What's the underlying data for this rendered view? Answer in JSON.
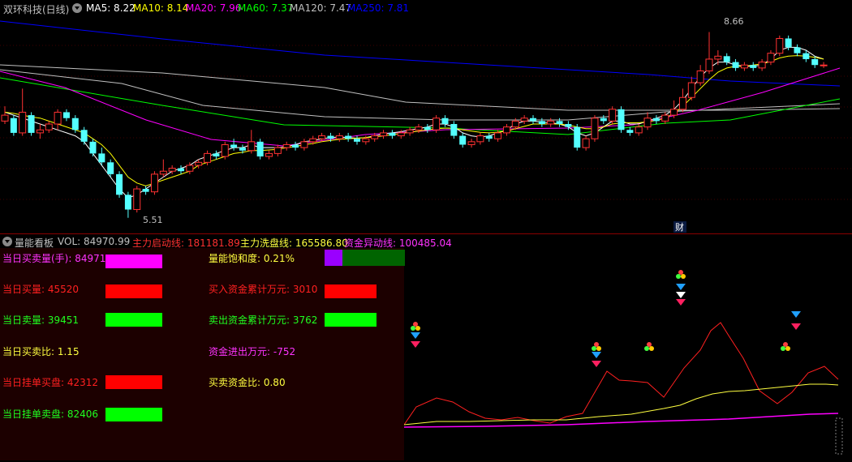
{
  "header": {
    "title": "双环科技(日线)",
    "ma5": "MA5: 8.22",
    "ma10": "MA10: 8.14",
    "ma20": "MA20: 7.96",
    "ma60": "MA60: 7.37",
    "ma120": "MA120: 7.47",
    "ma250": "MA250: 7.81"
  },
  "main_chart": {
    "high_label": "8.66",
    "low_label": "5.51",
    "cai_marker": "财"
  },
  "lower_header": {
    "title": "量能看板",
    "vol": "VOL: 84970.99",
    "zl_qd": "主力启动线: 181181.89",
    "zl_xp": "主力洗盘线: 165586.80",
    "zj_yd": "资金异动线: 100485.04"
  },
  "panel": {
    "left": [
      {
        "label": "当日买卖量(手): 84971",
        "color": "#ff33ff",
        "box": "#ff00ff"
      },
      {
        "label": "当日买量: 45520",
        "color": "#ff2020",
        "box": "#ff0000"
      },
      {
        "label": "当日卖量: 39451",
        "color": "#20ff20",
        "box": "#00ff00"
      },
      {
        "label": "当日买卖比: 1.15",
        "color": "#ffff40",
        "box": ""
      },
      {
        "label": "当日挂单买盘: 42312",
        "color": "#ff2020",
        "box": "#ff0000"
      },
      {
        "label": "当日挂单卖盘: 82406",
        "color": "#20ff20",
        "box": "#00ff00"
      }
    ],
    "right": [
      {
        "label": "量能饱和度: 0.21%",
        "color": "#ffff40",
        "box": "split"
      },
      {
        "label": "买入资金累计万元: 3010",
        "color": "#ff2020",
        "box": "#ff0000"
      },
      {
        "label": "卖出资金累计万元: 3762",
        "color": "#20ff20",
        "box": "#00ff00"
      },
      {
        "label": "资金进出万元: -752",
        "color": "#ff33ff",
        "box": ""
      },
      {
        "label": "买卖资金比: 0.80",
        "color": "#ffff40",
        "box": ""
      }
    ]
  },
  "colors": {
    "up": "#ff3232",
    "down": "#54ffff",
    "ma5": "#ffffff",
    "ma10": "#ffff00",
    "ma20": "#ff00ff",
    "ma60": "#00ff00",
    "ma120": "#c0c0c0",
    "ma250": "#0000ff"
  },
  "chart_data": {
    "type": "candlestick",
    "price_range": [
      5.3,
      8.9
    ],
    "candles": [
      [
        7.15,
        7.25,
        7.4,
        7.1
      ],
      [
        7.2,
        6.95,
        7.25,
        6.9
      ],
      [
        6.95,
        7.3,
        7.7,
        6.9
      ],
      [
        7.25,
        6.95,
        7.3,
        6.9
      ],
      [
        6.95,
        7.0,
        7.1,
        6.85
      ],
      [
        7.0,
        7.1,
        7.15,
        6.95
      ],
      [
        7.1,
        7.3,
        7.35,
        7.0
      ],
      [
        7.3,
        7.2,
        7.35,
        7.15
      ],
      [
        7.2,
        7.0,
        7.25,
        6.95
      ],
      [
        7.0,
        6.8,
        7.05,
        6.75
      ],
      [
        6.8,
        6.6,
        6.85,
        6.55
      ],
      [
        6.6,
        6.45,
        6.7,
        6.4
      ],
      [
        6.45,
        6.25,
        6.5,
        6.2
      ],
      [
        6.25,
        5.9,
        6.3,
        5.85
      ],
      [
        5.9,
        5.65,
        5.95,
        5.51
      ],
      [
        5.65,
        6.0,
        6.05,
        5.6
      ],
      [
        6.0,
        5.95,
        6.05,
        5.9
      ],
      [
        5.95,
        6.25,
        6.3,
        5.9
      ],
      [
        6.25,
        6.3,
        6.5,
        6.2
      ],
      [
        6.3,
        6.35,
        6.4,
        6.25
      ],
      [
        6.35,
        6.3,
        6.4,
        6.25
      ],
      [
        6.3,
        6.4,
        6.45,
        6.25
      ],
      [
        6.4,
        6.45,
        6.5,
        6.35
      ],
      [
        6.45,
        6.6,
        6.65,
        6.4
      ],
      [
        6.6,
        6.55,
        6.65,
        6.5
      ],
      [
        6.55,
        6.75,
        6.8,
        6.5
      ],
      [
        6.75,
        6.7,
        6.85,
        6.65
      ],
      [
        6.7,
        6.65,
        6.75,
        6.6
      ],
      [
        6.65,
        6.8,
        7.0,
        6.6
      ],
      [
        6.8,
        6.55,
        6.85,
        6.5
      ],
      [
        6.55,
        6.6,
        6.65,
        6.5
      ],
      [
        6.6,
        6.7,
        6.75,
        6.55
      ],
      [
        6.7,
        6.75,
        6.8,
        6.65
      ],
      [
        6.75,
        6.7,
        6.8,
        6.65
      ],
      [
        6.7,
        6.8,
        6.85,
        6.65
      ],
      [
        6.8,
        6.85,
        6.9,
        6.75
      ],
      [
        6.85,
        6.9,
        6.95,
        6.8
      ],
      [
        6.9,
        6.85,
        6.95,
        6.8
      ],
      [
        6.85,
        6.9,
        6.95,
        6.8
      ],
      [
        6.9,
        6.85,
        6.95,
        6.8
      ],
      [
        6.85,
        6.8,
        6.9,
        6.75
      ],
      [
        6.8,
        6.85,
        6.9,
        6.75
      ],
      [
        6.85,
        6.9,
        6.95,
        6.8
      ],
      [
        6.9,
        6.95,
        7.0,
        6.85
      ],
      [
        6.95,
        6.9,
        7.0,
        6.85
      ],
      [
        6.9,
        6.95,
        7.0,
        6.85
      ],
      [
        6.95,
        7.0,
        7.05,
        6.9
      ],
      [
        7.0,
        7.05,
        7.1,
        6.95
      ],
      [
        7.05,
        7.0,
        7.1,
        6.95
      ],
      [
        7.0,
        7.2,
        7.25,
        6.95
      ],
      [
        7.2,
        7.1,
        7.25,
        7.05
      ],
      [
        7.1,
        6.9,
        7.15,
        6.85
      ],
      [
        6.9,
        6.75,
        6.95,
        6.7
      ],
      [
        6.75,
        6.8,
        6.85,
        6.7
      ],
      [
        6.8,
        6.9,
        6.95,
        6.75
      ],
      [
        6.9,
        6.85,
        6.95,
        6.8
      ],
      [
        6.85,
        6.95,
        7.0,
        6.8
      ],
      [
        6.95,
        7.05,
        7.1,
        6.9
      ],
      [
        7.05,
        7.15,
        7.2,
        7.0
      ],
      [
        7.15,
        7.2,
        7.25,
        7.1
      ],
      [
        7.2,
        7.15,
        7.25,
        7.1
      ],
      [
        7.15,
        7.1,
        7.2,
        7.05
      ],
      [
        7.1,
        7.15,
        7.2,
        7.05
      ],
      [
        7.15,
        7.1,
        7.2,
        7.05
      ],
      [
        7.1,
        7.05,
        7.15,
        7.0
      ],
      [
        7.05,
        6.7,
        7.1,
        6.65
      ],
      [
        6.7,
        6.85,
        6.9,
        6.65
      ],
      [
        6.85,
        7.2,
        7.25,
        6.8
      ],
      [
        7.2,
        7.15,
        7.25,
        7.1
      ],
      [
        7.15,
        7.35,
        7.4,
        7.1
      ],
      [
        7.35,
        7.0,
        7.4,
        6.95
      ],
      [
        7.0,
        6.95,
        7.05,
        6.9
      ],
      [
        6.95,
        7.05,
        7.1,
        6.9
      ],
      [
        7.05,
        7.2,
        7.3,
        7.0
      ],
      [
        7.2,
        7.15,
        7.25,
        7.1
      ],
      [
        7.15,
        7.25,
        7.3,
        7.1
      ],
      [
        7.25,
        7.35,
        7.5,
        7.2
      ],
      [
        7.35,
        7.55,
        7.7,
        7.3
      ],
      [
        7.55,
        7.8,
        7.9,
        7.5
      ],
      [
        7.8,
        8.0,
        8.1,
        7.75
      ],
      [
        8.0,
        8.2,
        8.66,
        7.95
      ],
      [
        8.2,
        8.25,
        8.35,
        8.1
      ],
      [
        8.25,
        8.15,
        8.3,
        8.1
      ],
      [
        8.15,
        8.05,
        8.2,
        8.0
      ],
      [
        8.05,
        8.1,
        8.15,
        8.0
      ],
      [
        8.1,
        8.05,
        8.15,
        8.0
      ],
      [
        8.05,
        8.15,
        8.2,
        8.0
      ],
      [
        8.15,
        8.3,
        8.35,
        8.1
      ],
      [
        8.3,
        8.55,
        8.6,
        8.25
      ],
      [
        8.55,
        8.4,
        8.6,
        8.35
      ],
      [
        8.4,
        8.3,
        8.45,
        8.25
      ],
      [
        8.3,
        8.2,
        8.35,
        8.15
      ],
      [
        8.2,
        8.1,
        8.25,
        8.05
      ],
      [
        8.1,
        8.1,
        8.15,
        8.05
      ]
    ],
    "ma_lines": {
      "MA5": [
        7.3,
        7.25,
        7.2,
        7.15,
        7.1,
        7.05,
        7.0,
        6.95,
        6.9,
        6.8,
        6.6,
        6.4,
        6.2,
        6.0,
        5.85,
        5.9,
        6.0,
        6.1,
        6.2,
        6.3,
        6.35,
        6.4,
        6.5,
        6.55,
        6.6,
        6.65,
        6.7,
        6.7,
        6.75,
        6.7,
        6.7,
        6.7,
        6.72,
        6.75,
        6.8,
        6.82,
        6.85,
        6.87,
        6.88,
        6.87,
        6.86,
        6.87,
        6.9,
        6.93,
        6.95,
        6.97,
        7.0,
        7.02,
        7.05,
        7.1,
        7.1,
        7.05,
        6.95,
        6.9,
        6.88,
        6.9,
        6.95,
        7.0,
        7.1,
        7.15,
        7.15,
        7.13,
        7.12,
        7.1,
        7.05,
        6.95,
        6.9,
        6.95,
        7.05,
        7.15,
        7.15,
        7.1,
        7.1,
        7.15,
        7.2,
        7.25,
        7.35,
        7.5,
        7.7,
        7.9,
        8.05,
        8.15,
        8.15,
        8.1,
        8.08,
        8.08,
        8.1,
        8.2,
        8.35,
        8.4,
        8.4,
        8.35,
        8.25,
        8.2
      ],
      "MA10": [
        7.3,
        7.28,
        7.25,
        7.22,
        7.2,
        7.15,
        7.1,
        7.05,
        7.0,
        6.95,
        6.85,
        6.75,
        6.6,
        6.4,
        6.2,
        6.1,
        6.05,
        6.1,
        6.15,
        6.2,
        6.25,
        6.3,
        6.4,
        6.45,
        6.5,
        6.55,
        6.6,
        6.62,
        6.65,
        6.65,
        6.66,
        6.67,
        6.7,
        6.72,
        6.75,
        6.77,
        6.8,
        6.82,
        6.84,
        6.85,
        6.86,
        6.87,
        6.88,
        6.9,
        6.92,
        6.94,
        6.96,
        6.98,
        7.0,
        7.02,
        7.03,
        7.03,
        7.0,
        6.98,
        6.96,
        6.95,
        6.96,
        6.98,
        7.02,
        7.06,
        7.1,
        7.1,
        7.1,
        7.1,
        7.08,
        7.05,
        7.02,
        7.02,
        7.05,
        7.1,
        7.12,
        7.12,
        7.12,
        7.14,
        7.16,
        7.2,
        7.28,
        7.4,
        7.55,
        7.7,
        7.85,
        7.98,
        8.05,
        8.08,
        8.08,
        8.1,
        8.12,
        8.16,
        8.22,
        8.25,
        8.26,
        8.25,
        8.23,
        8.2
      ]
    }
  }
}
